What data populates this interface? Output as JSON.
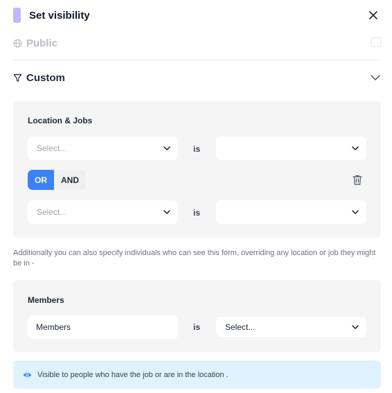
{
  "dialog": {
    "title": "Set visibility",
    "accent_color": "#c4b5fd"
  },
  "public_option": {
    "label": "Public",
    "icon": "globe-icon",
    "checked": false
  },
  "custom_option": {
    "label": "Custom",
    "icon": "filter-icon",
    "expanded": true
  },
  "location_jobs": {
    "title": "Location & Jobs",
    "operator_label": "is",
    "conditions": [
      {
        "field_placeholder": "Select...",
        "value": ""
      },
      {
        "field_placeholder": "Select...",
        "value": ""
      }
    ],
    "logic": {
      "or_label": "OR",
      "and_label": "AND",
      "selected": "OR"
    }
  },
  "help_text": "Additionally you can also specify individuals who can see this form, overriding any location or job they might be in -",
  "members": {
    "title": "Members",
    "field_value": "Members",
    "operator_label": "is",
    "value_placeholder": "Select..."
  },
  "info_banner": {
    "text": "Visible to people who have the job or are in the location .",
    "icon": "eye-icon"
  },
  "colors": {
    "primary": "#3b82f6",
    "panel_bg": "#f5f5f6",
    "info_bg": "#e0f2fe"
  }
}
